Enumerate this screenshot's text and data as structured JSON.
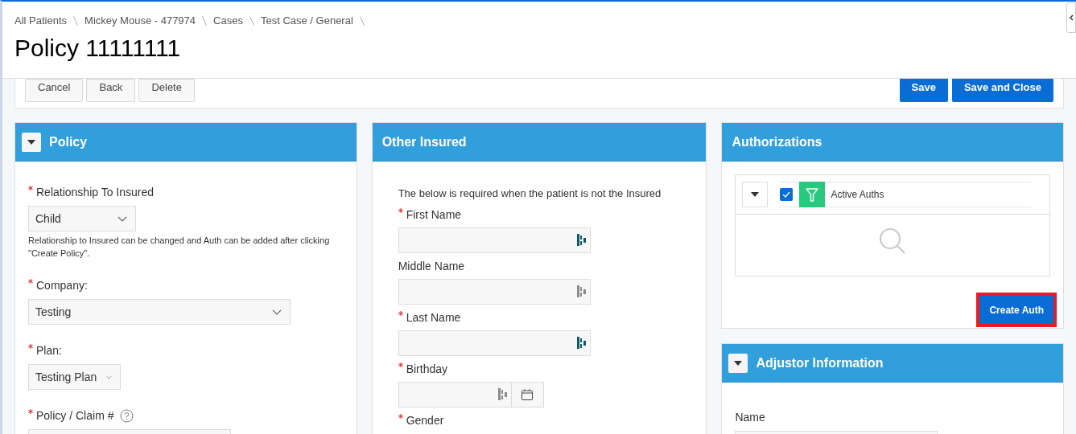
{
  "breadcrumbs": [
    "All Patients",
    "Mickey Mouse - 477974",
    "Cases",
    "Test Case / General"
  ],
  "title": "Policy 11111111",
  "toolbar": {
    "left_buttons": [
      "Cancel",
      "Back",
      "Delete"
    ],
    "right_buttons": [
      "Save",
      "Save and Close"
    ]
  },
  "policy_panel": {
    "title": "Policy",
    "collapsible": true,
    "items": [
      {
        "kind": "select",
        "label": "Relationship To Insured",
        "required": true,
        "value": "Child"
      },
      {
        "kind": "note",
        "text": "Relationship to Insured can be changed and Auth can be added after clicking \"Create Policy\"."
      },
      {
        "kind": "select",
        "label": "Company:",
        "required": true,
        "value": "Testing"
      },
      {
        "kind": "select",
        "label": "Plan:",
        "required": true,
        "value": "Testing Plan"
      },
      {
        "kind": "text",
        "label": "Policy / Claim #",
        "required": true,
        "help": true
      }
    ]
  },
  "other_insured_panel": {
    "title": "Other Insured",
    "collapsible": false,
    "items": [
      {
        "kind": "intro",
        "text": "The below is required when the patient is not the Insured"
      },
      {
        "kind": "text",
        "label": "First Name",
        "required": true,
        "autofill_active": true
      },
      {
        "kind": "text",
        "label": "Middle Name",
        "required": false,
        "autofill_active": false
      },
      {
        "kind": "text",
        "label": "Last Name",
        "required": true,
        "autofill_active": true
      },
      {
        "kind": "date",
        "label": "Birthday",
        "required": true,
        "autofill_active": false
      },
      {
        "kind": "label",
        "label": "Gender",
        "required": true
      }
    ]
  },
  "authorizations_panel": {
    "title": "Authorizations",
    "collapsible": false,
    "filter_checked": true,
    "filter": "Active Auths",
    "button": "Create Auth",
    "button_highlighted": true
  },
  "adjustor_panel": {
    "title": "Adjustor Information",
    "collapsible": true,
    "items": [
      {
        "kind": "text",
        "label": "Name",
        "required": false
      }
    ]
  }
}
